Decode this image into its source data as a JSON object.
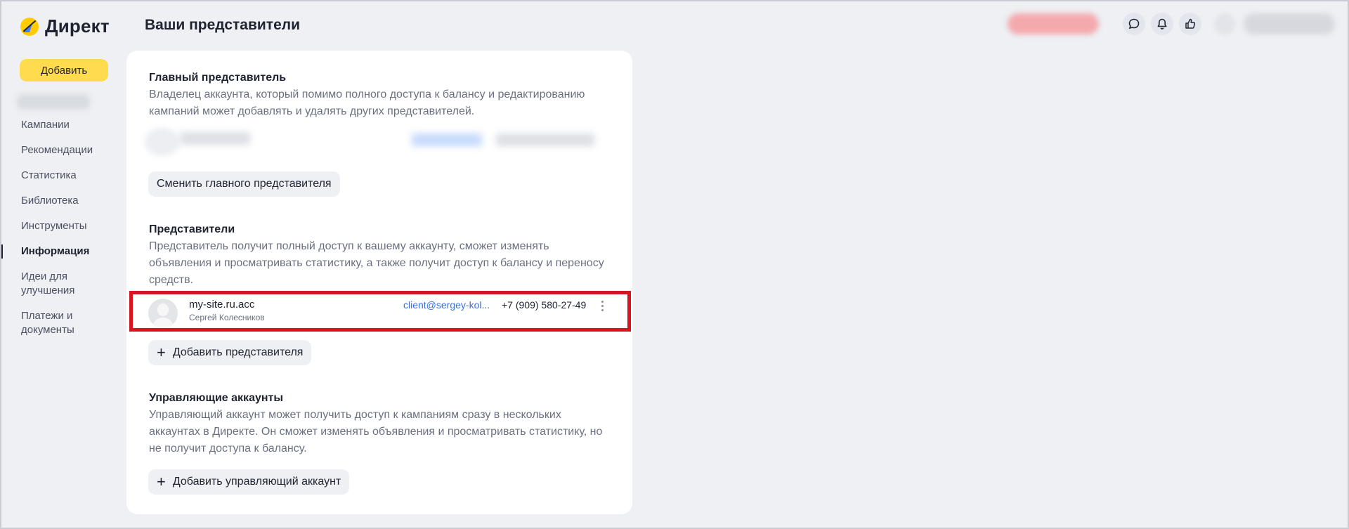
{
  "app": {
    "logo_text": "Директ",
    "page_title": "Ваши представители"
  },
  "sidebar": {
    "add_label": "Добавить",
    "items": [
      {
        "label": "Кампании",
        "active": false
      },
      {
        "label": "Рекомендации",
        "active": false
      },
      {
        "label": "Статистика",
        "active": false
      },
      {
        "label": "Библиотека",
        "active": false
      },
      {
        "label": "Инструменты",
        "active": false
      },
      {
        "label": "Информация",
        "active": true
      },
      {
        "label": "Идеи для\nулучшения",
        "active": false
      },
      {
        "label": "Платежи и\nдокументы",
        "active": false
      }
    ]
  },
  "header_icons": [
    "chat-icon",
    "bell-icon",
    "thumbs-up-icon"
  ],
  "main": {
    "owner": {
      "title": "Главный представитель",
      "desc": "Владелец аккаунта, который помимо полного доступа к балансу и редактированию кампаний может добавлять и удалять других представителей.",
      "change_label": "Сменить главного представителя"
    },
    "reps": {
      "title": "Представители",
      "desc": "Представитель получит полный доступ к вашему аккаунту, сможет изменять объявления и просматривать статистику, а также получит доступ к балансу и переносу средств.",
      "row": {
        "login": "my-site.ru.acc",
        "name": "Сергей Колесников",
        "email": "client@sergey-kol...",
        "phone": "+7 (909) 580-27-49"
      },
      "add_label": "Добавить представителя"
    },
    "managers": {
      "title": "Управляющие аккаунты",
      "desc": "Управляющий аккаунт может получить доступ к кампаниям сразу в нескольких аккаунтах в Директе. Он сможет изменять объявления и просматривать статистику, но не получит доступа к балансу.",
      "add_label": "Добавить управляющий аккаунт"
    }
  },
  "colors": {
    "accent_yellow": "#ffdb4d",
    "highlight_red": "#d8141e",
    "link_blue": "#3b6fd8"
  }
}
